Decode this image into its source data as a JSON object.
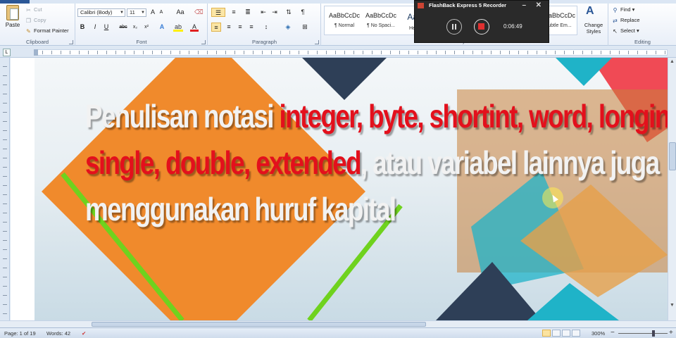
{
  "clipboard": {
    "label": "Clipboard",
    "paste": "Paste",
    "cut": "Cut",
    "copy": "Copy",
    "format_painter": "Format Painter"
  },
  "font": {
    "label": "Font",
    "family": "Calibri (Body)",
    "size": "11",
    "bold": "B",
    "italic": "I",
    "underline": "U",
    "strike": "abc",
    "subscript": "x₂",
    "superscript": "x²",
    "grow": "A",
    "shrink": "A",
    "case": "Aa"
  },
  "paragraph": {
    "label": "Paragraph",
    "pilcrow": "¶"
  },
  "styles": {
    "label": "Styles",
    "items": [
      {
        "sample": "AaBbCcDc",
        "name": "¶ Normal"
      },
      {
        "sample": "AaBbCcDc",
        "name": "¶ No Spaci..."
      },
      {
        "sample": "AaBb",
        "name": "Headi..."
      },
      {
        "sample": "AaBbCcDc",
        "name": "ubtle Em..."
      }
    ],
    "change_styles": "Change Styles"
  },
  "editing": {
    "label": "Editing",
    "find": "Find",
    "replace": "Replace",
    "select": "Select"
  },
  "recorder": {
    "title": "FlashBack Express 5 Recorder",
    "time": "0:06:49"
  },
  "slide": {
    "line1_a": "Penulisan notasi ",
    "line1_b": "integer, byte, shortint, word, longint,",
    "line2_a": "single, double, extended",
    "line2_b": ", atau variabel lainnya juga",
    "line3": "menggunakan huruf kapital"
  },
  "status": {
    "page": "Page: 1 of 19",
    "words": "Words: 42",
    "zoom": "300%"
  },
  "colors": {
    "red_text": "#e3101c",
    "orange": "#f08a2c",
    "green": "#6fd21e",
    "navy": "#2e3f57",
    "teal": "#1fb3c8",
    "coral": "#f04a55"
  }
}
